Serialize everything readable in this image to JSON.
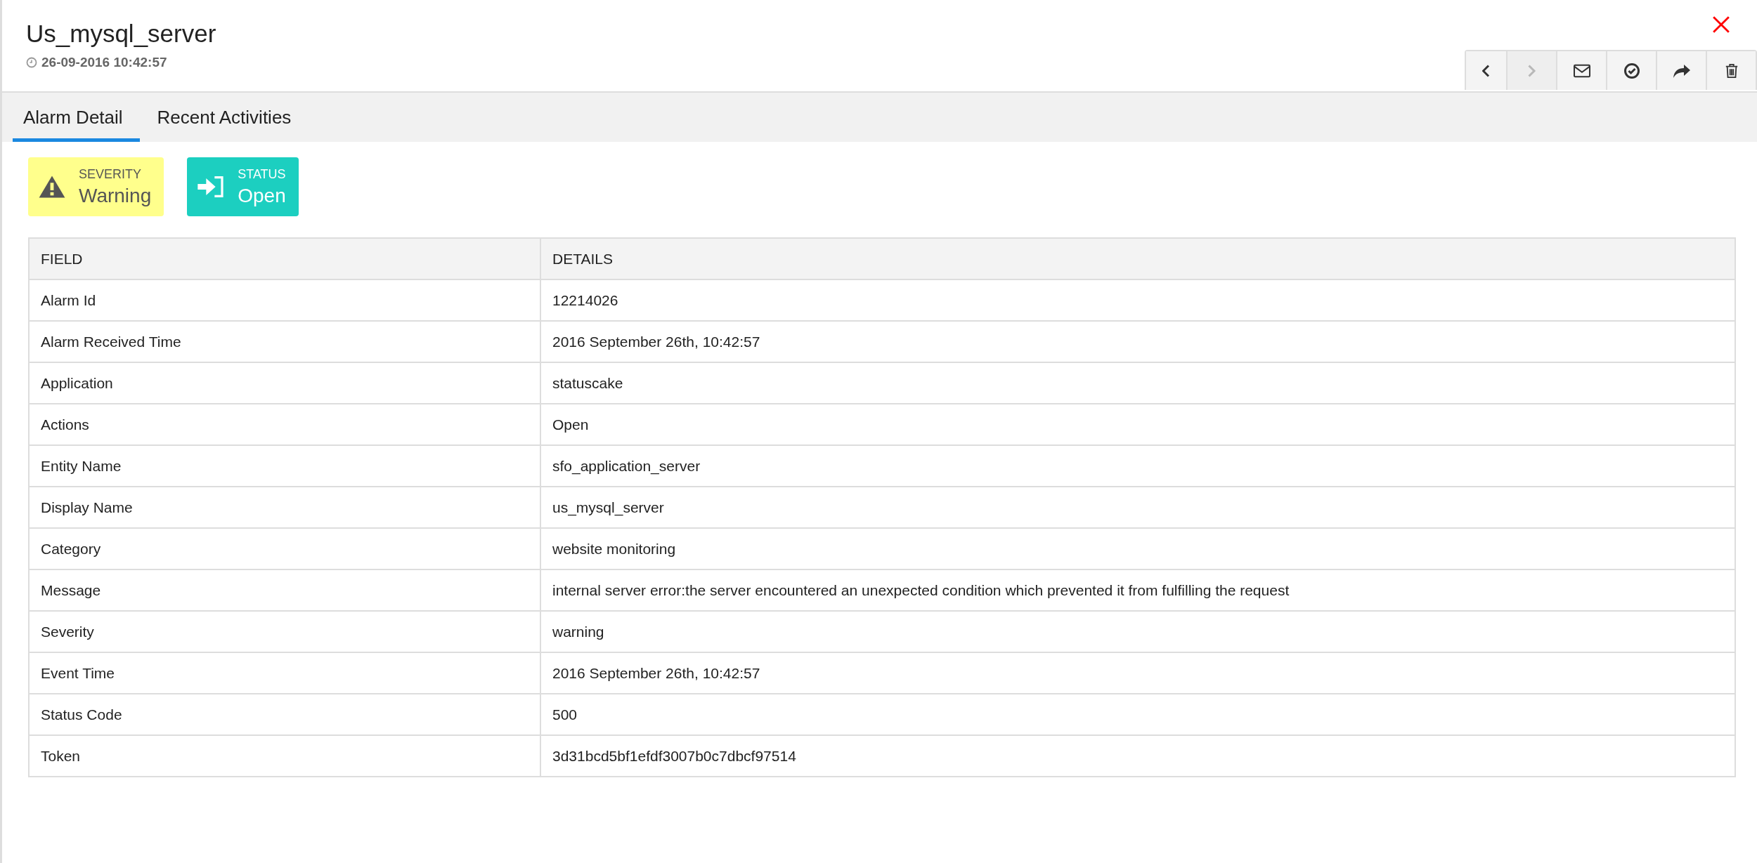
{
  "window": {
    "title": "Us_mysql_server",
    "timestamp": "26-09-2016 10:42:57"
  },
  "toolbar": [
    {
      "kind": "prev",
      "disabled": false
    },
    {
      "kind": "next",
      "disabled": true
    },
    {
      "kind": "mail",
      "disabled": false
    },
    {
      "kind": "check",
      "disabled": false
    },
    {
      "kind": "share",
      "disabled": false
    },
    {
      "kind": "delete",
      "disabled": false
    }
  ],
  "tabs": [
    {
      "label": "Alarm Detail",
      "selected": true
    },
    {
      "label": "Recent Activities",
      "selected": false
    }
  ],
  "badges": [
    {
      "kind": "warning",
      "label": "SEVERITY",
      "value": "Warning",
      "color": "#ffff8c"
    },
    {
      "kind": "status",
      "label": "STATUS",
      "value": "Open",
      "color": "#1ccfc0"
    }
  ],
  "table": {
    "columns": [
      "FIELD",
      "DETAILS"
    ],
    "rows": [
      [
        "Alarm Id",
        "12214026"
      ],
      [
        "Alarm Received Time",
        "2016 September 26th, 10:42:57"
      ],
      [
        "Application",
        "statuscake"
      ],
      [
        "Actions",
        "Open"
      ],
      [
        "Entity Name",
        "sfo_application_server"
      ],
      [
        "Display Name",
        "us_mysql_server"
      ],
      [
        "Category",
        "website monitoring"
      ],
      [
        "Message",
        "internal server error:the server encountered an unexpected condition which prevented it from fulfilling the request"
      ],
      [
        "Severity",
        "warning"
      ],
      [
        "Event Time",
        "2016 September 26th, 10:42:57"
      ],
      [
        "Status Code",
        "500"
      ],
      [
        "Token",
        "3d31bcd5bf1efdf3007b0c7dbcf97514"
      ]
    ]
  }
}
